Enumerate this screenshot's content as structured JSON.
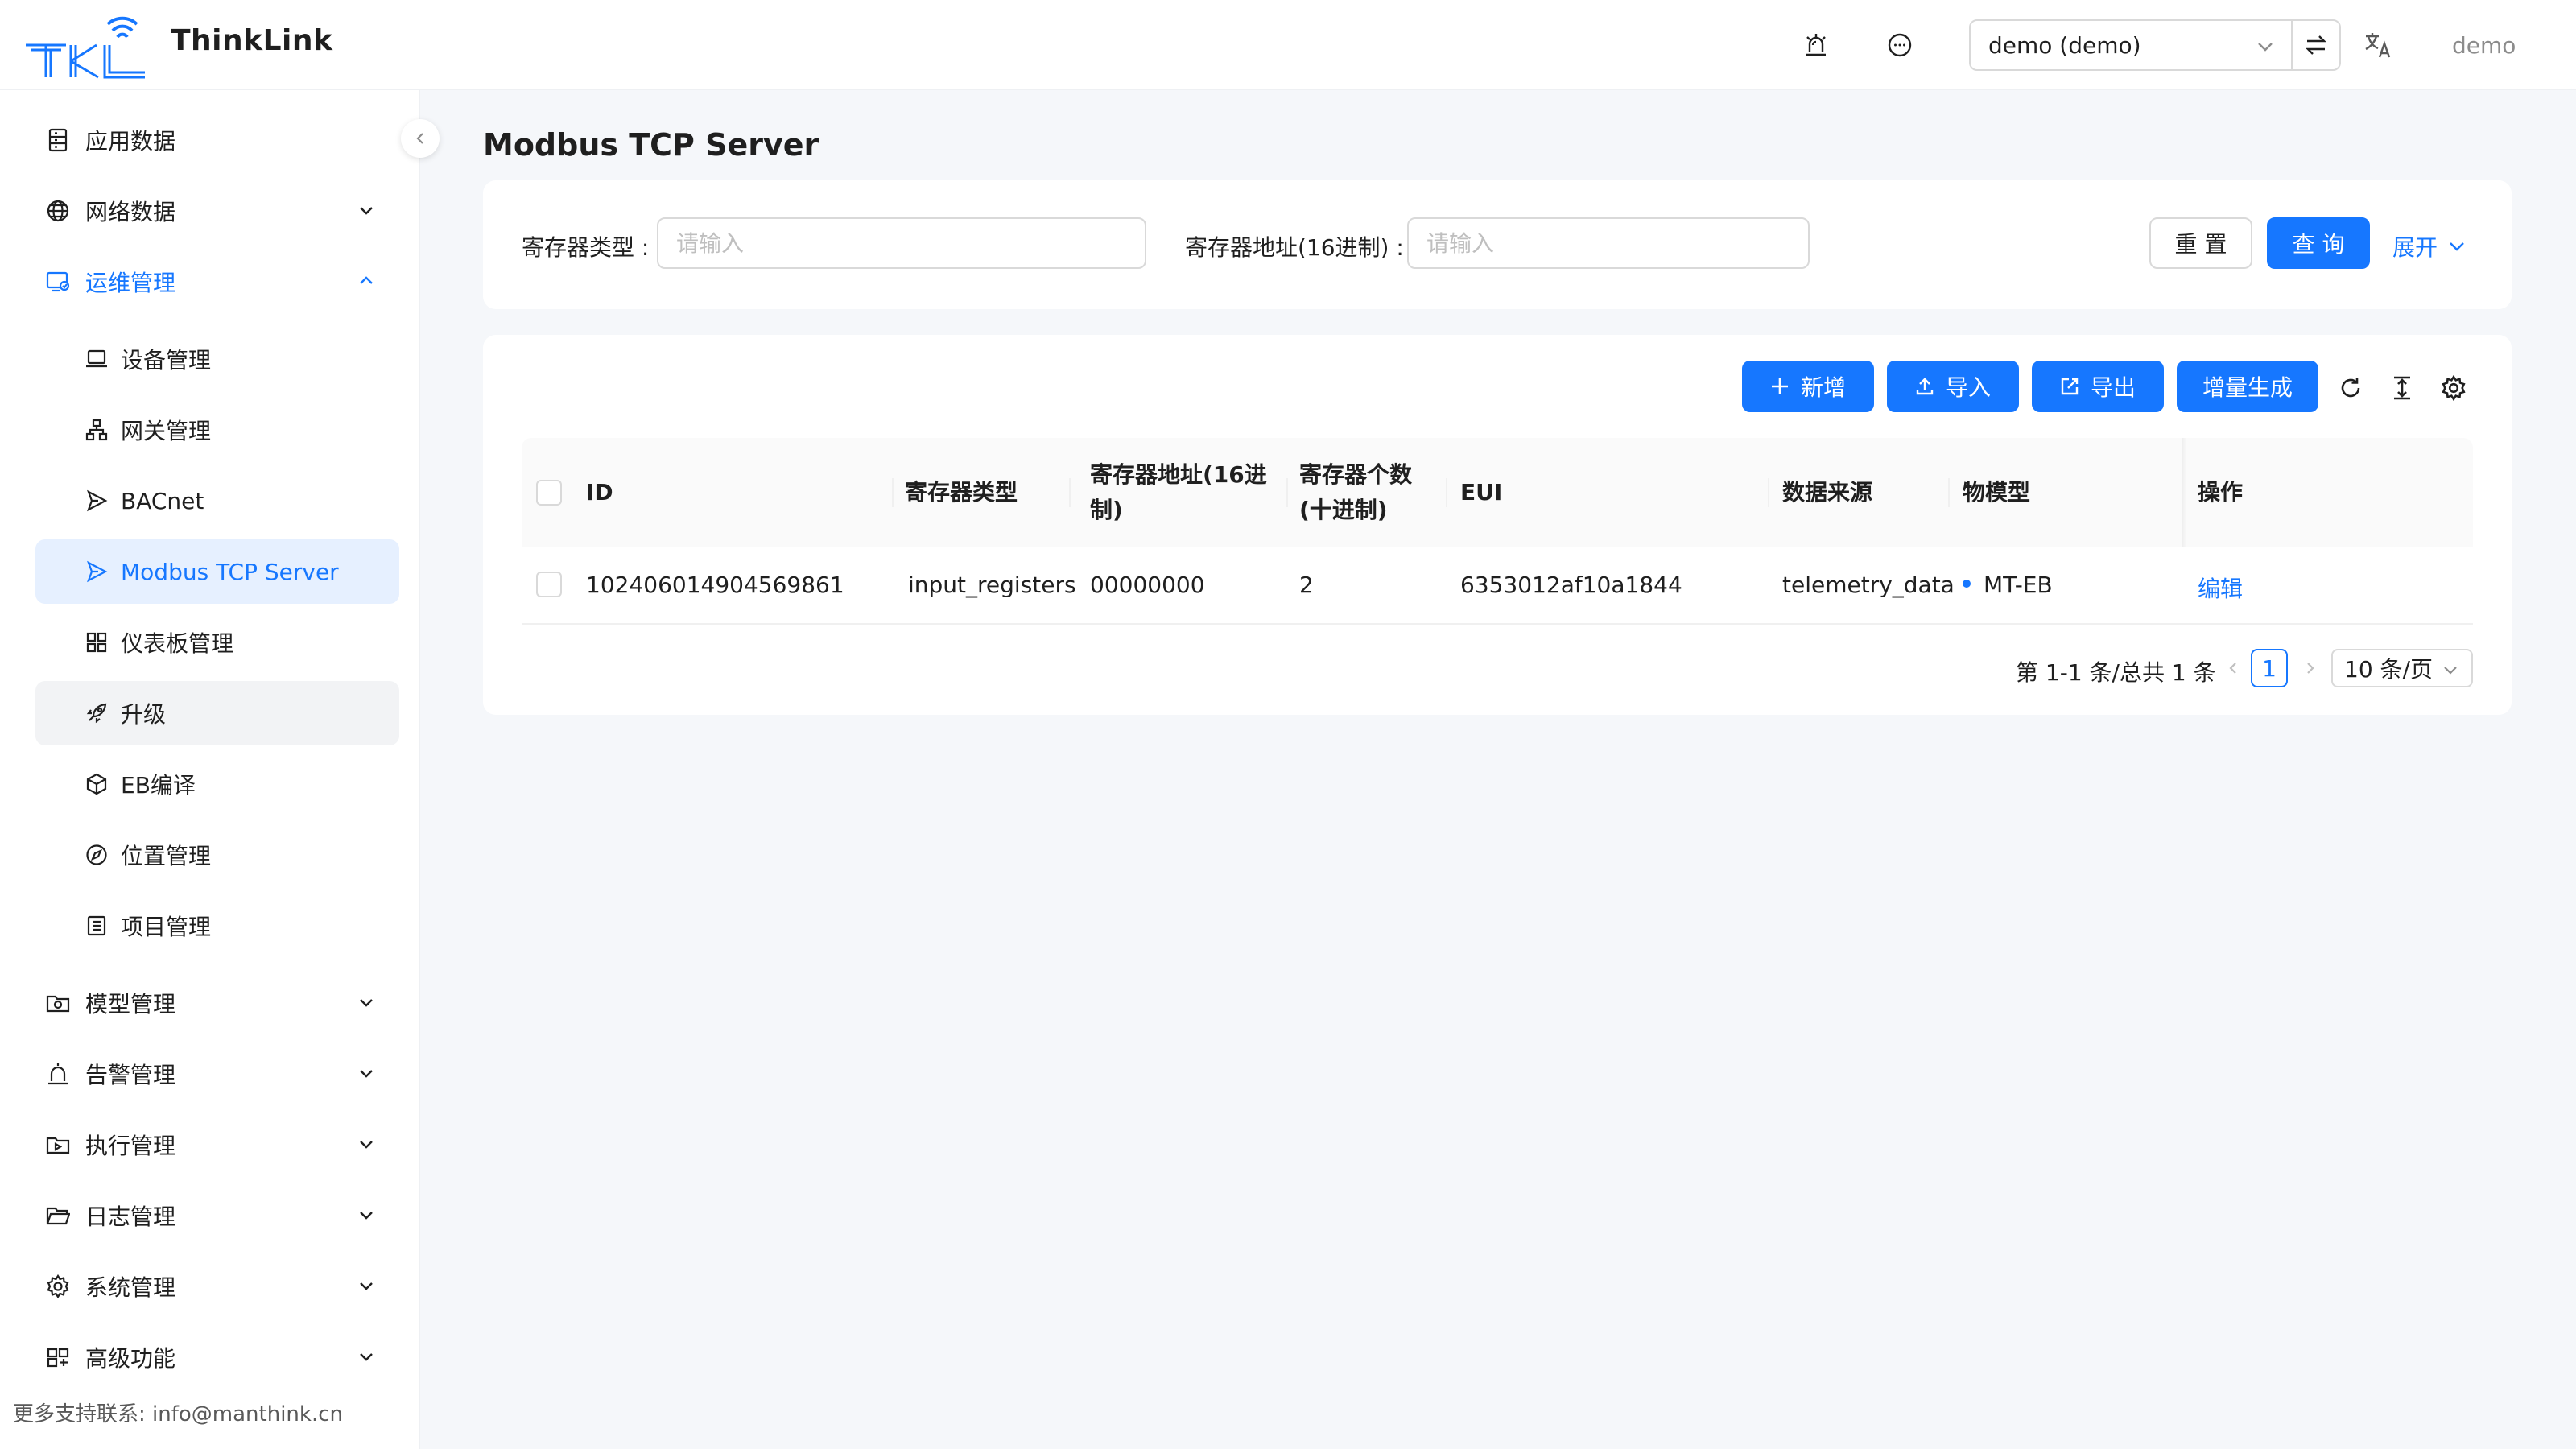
{
  "header": {
    "brand": "ThinkLink",
    "tenant": "demo (demo)",
    "user": "demo",
    "icons": [
      "alarm-bell-icon",
      "message-icon",
      "swap-icon",
      "translate-icon"
    ]
  },
  "sidebar": {
    "menu": [
      {
        "label": "应用数据",
        "icon": "database-icon"
      },
      {
        "label": "网络数据",
        "icon": "globe-icon"
      },
      {
        "label": "运维管理",
        "icon": "ops-icon",
        "expanded": true
      },
      {
        "label": "模型管理",
        "icon": "model-icon"
      },
      {
        "label": "告警管理",
        "icon": "alarm-icon"
      },
      {
        "label": "执行管理",
        "icon": "exec-icon"
      },
      {
        "label": "日志管理",
        "icon": "folder-icon"
      },
      {
        "label": "系统管理",
        "icon": "gear-icon"
      },
      {
        "label": "高级功能",
        "icon": "grid-icon"
      }
    ],
    "submenu": [
      {
        "label": "设备管理",
        "icon": "laptop-icon"
      },
      {
        "label": "网关管理",
        "icon": "network-icon"
      },
      {
        "label": "BACnet",
        "icon": "send-icon"
      },
      {
        "label": "Modbus TCP Server",
        "icon": "send-icon",
        "selected": true
      },
      {
        "label": "仪表板管理",
        "icon": "dashboard-icon"
      },
      {
        "label": "升级",
        "icon": "rocket-icon"
      },
      {
        "label": "EB编译",
        "icon": "code-sandbox-icon"
      },
      {
        "label": "位置管理",
        "icon": "compass-icon"
      },
      {
        "label": "项目管理",
        "icon": "project-icon"
      }
    ],
    "footer": "更多支持联系: info@manthink.cn"
  },
  "page": {
    "title": "Modbus TCP Server"
  },
  "search": {
    "register_type_label": "寄存器类型 :",
    "register_type_placeholder": "请输入",
    "register_addr_label": "寄存器地址(16进制) :",
    "register_addr_placeholder": "请输入",
    "reset": "重 置",
    "query": "查 询",
    "expand": "展开"
  },
  "toolbar": {
    "add": "新增",
    "import": "导入",
    "export": "导出",
    "incremental": "增量生成"
  },
  "table": {
    "columns": {
      "id": "ID",
      "register_type": "寄存器类型",
      "register_addr_1": "寄存器地址(16进",
      "register_addr_2": "制)",
      "register_count_1": "寄存器个数",
      "register_count_2": "(十进制)",
      "eui": "EUI",
      "data_source": "数据来源",
      "thing_model": "物模型",
      "operation": "操作"
    },
    "rows": [
      {
        "id": "102406014904569861",
        "register_type": "input_registers",
        "register_addr": "00000000",
        "register_count": "2",
        "eui": "6353012af10a1844",
        "data_source": "telemetry_data",
        "thing_model": "MT-EB",
        "action": "编辑"
      }
    ]
  },
  "pagination": {
    "total_text": "第 1-1 条/总共 1 条",
    "current": "1",
    "page_size": "10 条/页"
  },
  "colors": {
    "primary": "#1677ff",
    "background": "#f5f7fa",
    "selected_bg": "#e6f0ff"
  }
}
